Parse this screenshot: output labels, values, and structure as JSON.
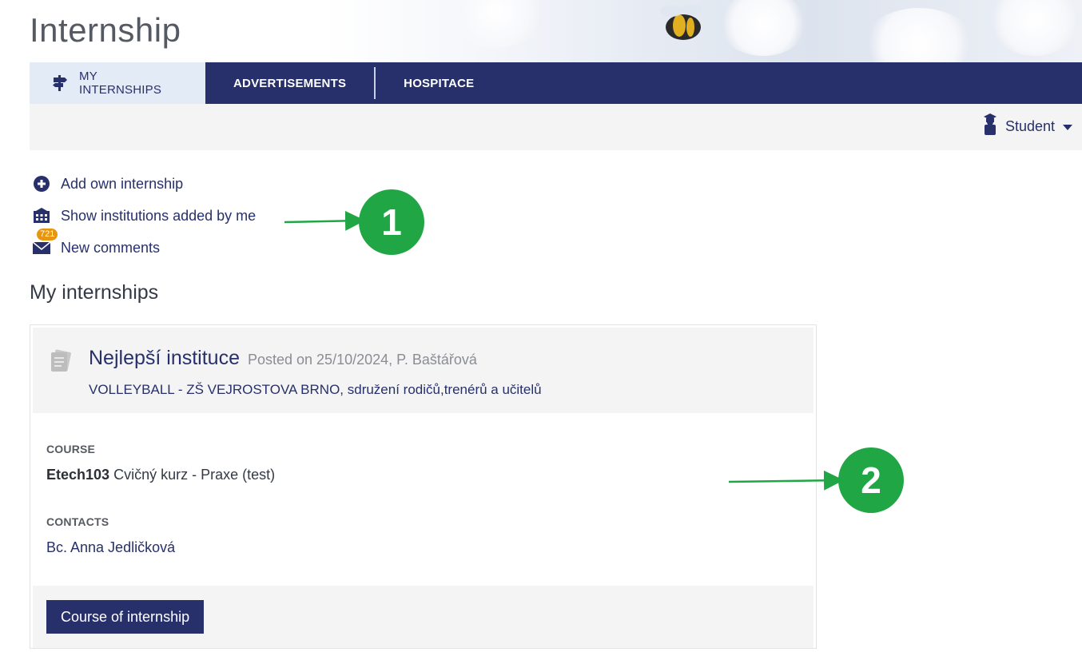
{
  "app": {
    "title": "Internship"
  },
  "nav": {
    "tabs": [
      {
        "label": "MY INTERNSHIPS",
        "active": true,
        "icon": "signpost-icon"
      },
      {
        "label": "ADVERTISEMENTS",
        "active": false
      },
      {
        "label": "HOSPITACE",
        "active": false
      }
    ]
  },
  "role": {
    "label": "Student",
    "icon": "student-icon",
    "caret_icon": "caret-down-icon"
  },
  "actions": [
    {
      "label": "Add own internship",
      "icon": "plus-circle-icon"
    },
    {
      "label": "Show institutions added by me",
      "icon": "building-icon"
    },
    {
      "label": "New comments",
      "icon": "envelope-icon",
      "badge": "721"
    }
  ],
  "section": {
    "title": "My internships"
  },
  "internship": {
    "institution": "Nejlepší instituce",
    "posted": "Posted on 25/10/2024, P. Baštářová",
    "subtitle": "VOLLEYBALL - ZŠ VEJROSTOVA BRNO, sdružení rodičů,trenérů a učitelů",
    "course_label": "COURSE",
    "course_code": "Etech103",
    "course_name": "Cvičný kurz - Praxe (test)",
    "contacts_label": "CONTACTS",
    "contact_name": "Bc. Anna Jedličková",
    "button_label": "Course of internship"
  },
  "annotations": [
    {
      "number": "1"
    },
    {
      "number": "2"
    }
  ],
  "colors": {
    "navy": "#27306b",
    "active_tab": "#e3ebf7",
    "panel_gray": "#f4f4f4",
    "badge_orange": "#e8960f",
    "callout_green": "#21a645"
  }
}
